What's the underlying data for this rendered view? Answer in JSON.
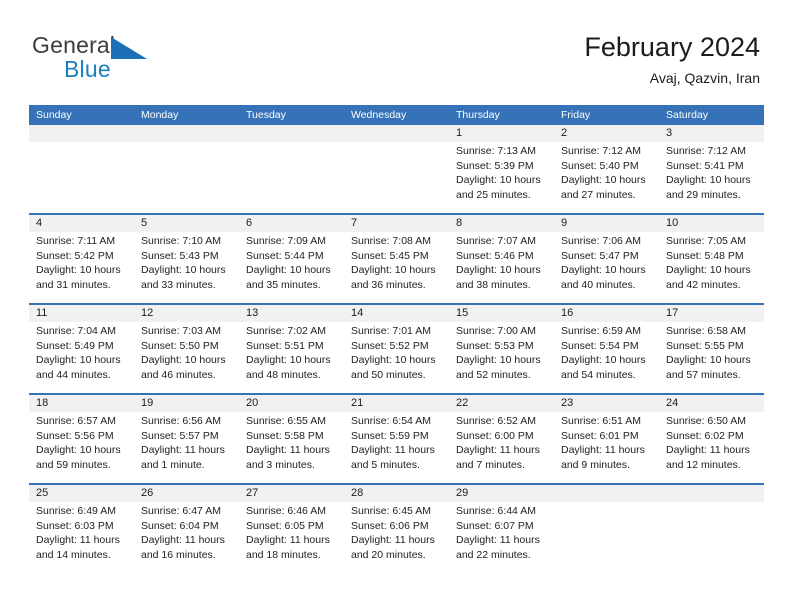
{
  "brand": {
    "name_top": "General",
    "name_bottom": "Blue",
    "accent_color": "#1a7fc1",
    "triangle_icon": "triangle-icon"
  },
  "header": {
    "title": "February 2024",
    "subtitle": "Avaj, Qazvin, Iran"
  },
  "theme": {
    "header_blue": "#3572b8",
    "row_band_gray": "#f1f1f1",
    "text_color": "#222222"
  },
  "weekdays": [
    "Sunday",
    "Monday",
    "Tuesday",
    "Wednesday",
    "Thursday",
    "Friday",
    "Saturday"
  ],
  "weeks": [
    {
      "days": [
        {
          "num": "",
          "lines": []
        },
        {
          "num": "",
          "lines": []
        },
        {
          "num": "",
          "lines": []
        },
        {
          "num": "",
          "lines": []
        },
        {
          "num": "1",
          "lines": [
            "Sunrise: 7:13 AM",
            "Sunset: 5:39 PM",
            "Daylight: 10 hours",
            "and 25 minutes."
          ]
        },
        {
          "num": "2",
          "lines": [
            "Sunrise: 7:12 AM",
            "Sunset: 5:40 PM",
            "Daylight: 10 hours",
            "and 27 minutes."
          ]
        },
        {
          "num": "3",
          "lines": [
            "Sunrise: 7:12 AM",
            "Sunset: 5:41 PM",
            "Daylight: 10 hours",
            "and 29 minutes."
          ]
        }
      ]
    },
    {
      "days": [
        {
          "num": "4",
          "lines": [
            "Sunrise: 7:11 AM",
            "Sunset: 5:42 PM",
            "Daylight: 10 hours",
            "and 31 minutes."
          ]
        },
        {
          "num": "5",
          "lines": [
            "Sunrise: 7:10 AM",
            "Sunset: 5:43 PM",
            "Daylight: 10 hours",
            "and 33 minutes."
          ]
        },
        {
          "num": "6",
          "lines": [
            "Sunrise: 7:09 AM",
            "Sunset: 5:44 PM",
            "Daylight: 10 hours",
            "and 35 minutes."
          ]
        },
        {
          "num": "7",
          "lines": [
            "Sunrise: 7:08 AM",
            "Sunset: 5:45 PM",
            "Daylight: 10 hours",
            "and 36 minutes."
          ]
        },
        {
          "num": "8",
          "lines": [
            "Sunrise: 7:07 AM",
            "Sunset: 5:46 PM",
            "Daylight: 10 hours",
            "and 38 minutes."
          ]
        },
        {
          "num": "9",
          "lines": [
            "Sunrise: 7:06 AM",
            "Sunset: 5:47 PM",
            "Daylight: 10 hours",
            "and 40 minutes."
          ]
        },
        {
          "num": "10",
          "lines": [
            "Sunrise: 7:05 AM",
            "Sunset: 5:48 PM",
            "Daylight: 10 hours",
            "and 42 minutes."
          ]
        }
      ]
    },
    {
      "days": [
        {
          "num": "11",
          "lines": [
            "Sunrise: 7:04 AM",
            "Sunset: 5:49 PM",
            "Daylight: 10 hours",
            "and 44 minutes."
          ]
        },
        {
          "num": "12",
          "lines": [
            "Sunrise: 7:03 AM",
            "Sunset: 5:50 PM",
            "Daylight: 10 hours",
            "and 46 minutes."
          ]
        },
        {
          "num": "13",
          "lines": [
            "Sunrise: 7:02 AM",
            "Sunset: 5:51 PM",
            "Daylight: 10 hours",
            "and 48 minutes."
          ]
        },
        {
          "num": "14",
          "lines": [
            "Sunrise: 7:01 AM",
            "Sunset: 5:52 PM",
            "Daylight: 10 hours",
            "and 50 minutes."
          ]
        },
        {
          "num": "15",
          "lines": [
            "Sunrise: 7:00 AM",
            "Sunset: 5:53 PM",
            "Daylight: 10 hours",
            "and 52 minutes."
          ]
        },
        {
          "num": "16",
          "lines": [
            "Sunrise: 6:59 AM",
            "Sunset: 5:54 PM",
            "Daylight: 10 hours",
            "and 54 minutes."
          ]
        },
        {
          "num": "17",
          "lines": [
            "Sunrise: 6:58 AM",
            "Sunset: 5:55 PM",
            "Daylight: 10 hours",
            "and 57 minutes."
          ]
        }
      ]
    },
    {
      "days": [
        {
          "num": "18",
          "lines": [
            "Sunrise: 6:57 AM",
            "Sunset: 5:56 PM",
            "Daylight: 10 hours",
            "and 59 minutes."
          ]
        },
        {
          "num": "19",
          "lines": [
            "Sunrise: 6:56 AM",
            "Sunset: 5:57 PM",
            "Daylight: 11 hours",
            "and 1 minute."
          ]
        },
        {
          "num": "20",
          "lines": [
            "Sunrise: 6:55 AM",
            "Sunset: 5:58 PM",
            "Daylight: 11 hours",
            "and 3 minutes."
          ]
        },
        {
          "num": "21",
          "lines": [
            "Sunrise: 6:54 AM",
            "Sunset: 5:59 PM",
            "Daylight: 11 hours",
            "and 5 minutes."
          ]
        },
        {
          "num": "22",
          "lines": [
            "Sunrise: 6:52 AM",
            "Sunset: 6:00 PM",
            "Daylight: 11 hours",
            "and 7 minutes."
          ]
        },
        {
          "num": "23",
          "lines": [
            "Sunrise: 6:51 AM",
            "Sunset: 6:01 PM",
            "Daylight: 11 hours",
            "and 9 minutes."
          ]
        },
        {
          "num": "24",
          "lines": [
            "Sunrise: 6:50 AM",
            "Sunset: 6:02 PM",
            "Daylight: 11 hours",
            "and 12 minutes."
          ]
        }
      ]
    },
    {
      "days": [
        {
          "num": "25",
          "lines": [
            "Sunrise: 6:49 AM",
            "Sunset: 6:03 PM",
            "Daylight: 11 hours",
            "and 14 minutes."
          ]
        },
        {
          "num": "26",
          "lines": [
            "Sunrise: 6:47 AM",
            "Sunset: 6:04 PM",
            "Daylight: 11 hours",
            "and 16 minutes."
          ]
        },
        {
          "num": "27",
          "lines": [
            "Sunrise: 6:46 AM",
            "Sunset: 6:05 PM",
            "Daylight: 11 hours",
            "and 18 minutes."
          ]
        },
        {
          "num": "28",
          "lines": [
            "Sunrise: 6:45 AM",
            "Sunset: 6:06 PM",
            "Daylight: 11 hours",
            "and 20 minutes."
          ]
        },
        {
          "num": "29",
          "lines": [
            "Sunrise: 6:44 AM",
            "Sunset: 6:07 PM",
            "Daylight: 11 hours",
            "and 22 minutes."
          ]
        },
        {
          "num": "",
          "lines": []
        },
        {
          "num": "",
          "lines": []
        }
      ]
    }
  ]
}
